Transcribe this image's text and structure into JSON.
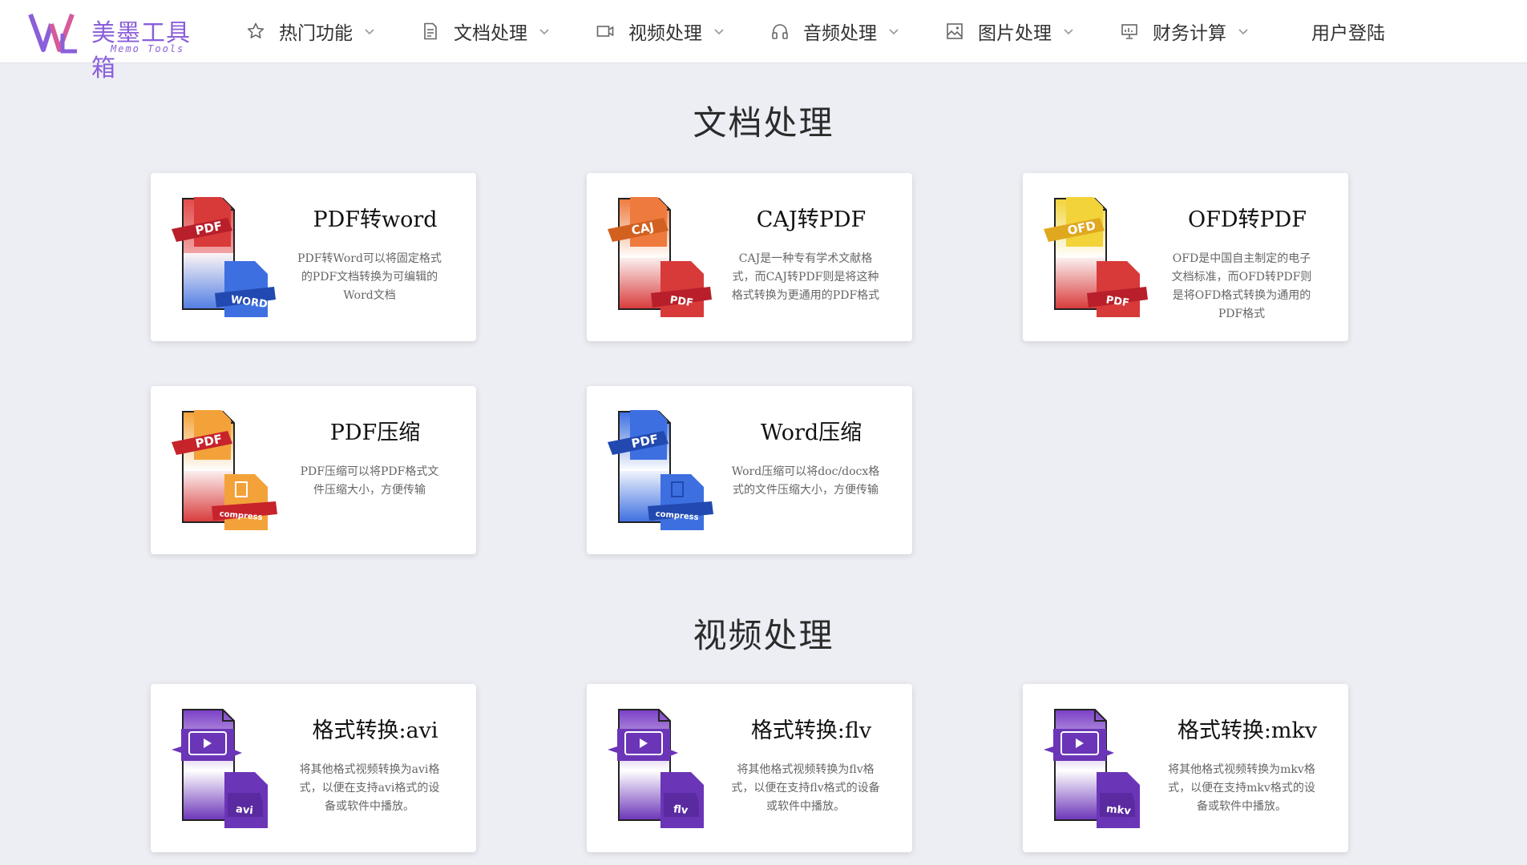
{
  "header": {
    "logo_text": "美墨工具箱",
    "logo_sub": "Memo Tools",
    "nav": [
      {
        "label": "热门功能",
        "icon": "star-icon"
      },
      {
        "label": "文档处理",
        "icon": "document-icon"
      },
      {
        "label": "视频处理",
        "icon": "video-icon"
      },
      {
        "label": "音频处理",
        "icon": "headphones-icon"
      },
      {
        "label": "图片处理",
        "icon": "image-icon"
      },
      {
        "label": "财务计算",
        "icon": "chart-board-icon"
      }
    ],
    "login": "用户登陆"
  },
  "sections": [
    {
      "title": "文档处理",
      "cards": [
        {
          "title": "PDF转word",
          "desc": "PDF转Word可以将固定格式的PDF文档转换为可编辑的Word文档",
          "top_label": "PDF",
          "bottom_label": "WORD"
        },
        {
          "title": "CAJ转PDF",
          "desc": "CAJ是一种专有学术文献格式，而CAJ转PDF则是将这种格式转换为更通用的PDF格式",
          "top_label": "CAJ",
          "bottom_label": "PDF"
        },
        {
          "title": "OFD转PDF",
          "desc": "OFD是中国自主制定的电子文档标准，而OFD转PDF则是将OFD格式转换为通用的PDF格式",
          "top_label": "OFD",
          "bottom_label": "PDF"
        },
        {
          "title": "PDF压缩",
          "desc": "PDF压缩可以将PDF格式文件压缩大小，方便传输",
          "top_label": "PDF",
          "bottom_label": "compress"
        },
        {
          "title": "Word压缩",
          "desc": "Word压缩可以将doc/docx格式的文件压缩大小，方便传输",
          "top_label": "PDF",
          "bottom_label": "compress"
        }
      ]
    },
    {
      "title": "视频处理",
      "cards": [
        {
          "title": "格式转换:avi",
          "desc": "将其他格式视频转换为avi格式，以便在支持avi格式的设备或软件中播放。",
          "bottom_label": "avi"
        },
        {
          "title": "格式转换:flv",
          "desc": "将其他格式视频转换为flv格式，以便在支持flv格式的设备或软件中播放。",
          "bottom_label": "flv"
        },
        {
          "title": "格式转换:mkv",
          "desc": "将其他格式视频转换为mkv格式，以便在支持mkv格式的设备或软件中播放。",
          "bottom_label": "mkv"
        }
      ]
    }
  ],
  "colors": {
    "brand": "#8b5fd9",
    "pdf_red": "#d83a3a",
    "word_blue": "#3d6fe0",
    "caj_orange": "#ee7a3e",
    "ofd_yellow": "#f2d33a",
    "compress_orange": "#f3a23a",
    "video_purple": "#6b35b8"
  }
}
